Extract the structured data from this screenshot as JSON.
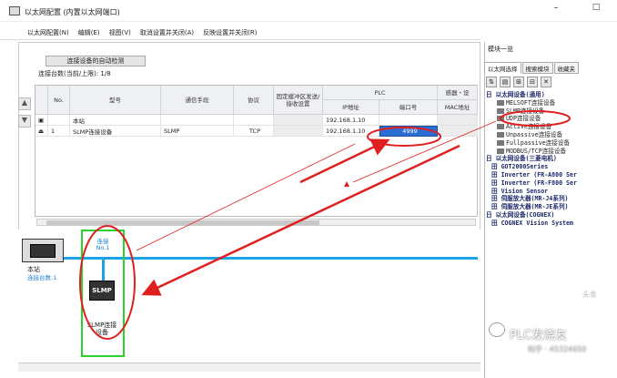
{
  "window": {
    "title": "以太网配置 (内置以太网端口)",
    "min_glyph": "–",
    "max_glyph": "□"
  },
  "menu": [
    "以太网配置(N)",
    "编辑(E)",
    "视图(V)",
    "取消设置并关闭(A)",
    "反映设置并关闭(R)"
  ],
  "toolbar": {
    "detect_label": "连接设备的自动检测",
    "count_label": "连接台数(当前/上限):  1/8"
  },
  "grid": {
    "headers": {
      "no": "No.",
      "model": "型号",
      "comm": "通信手段",
      "protocol": "协议",
      "fixed": "固定缓冲区发送/接收设置",
      "plc_group": "PLC",
      "ip": "IP地址",
      "port": "端口号",
      "sensor": "感器・设",
      "mac": "MAC地址"
    },
    "rows": [
      {
        "no": "",
        "model": "本站",
        "comm": "",
        "protocol": "",
        "ip": "192.168.1.10",
        "port": ""
      },
      {
        "no": "1",
        "model": "SLMP连接设备",
        "comm": "SLMP",
        "protocol": "TCP",
        "ip": "192.168.1.10",
        "port": "4999"
      }
    ]
  },
  "diagram": {
    "station_label": "本站",
    "station_count": "连接台数:1",
    "conn_label": "连接 No.1",
    "slmp_label": "SLMP",
    "device_label": "SLMP连接设备"
  },
  "right_panel": {
    "title": "模块一览",
    "tabs": [
      "以太网选择",
      "搜索模块",
      "收藏夹"
    ],
    "tree": [
      {
        "kind": "grp",
        "label": "日 以太网设备(通用)"
      },
      {
        "kind": "item",
        "label": "MELSOFT连接设备"
      },
      {
        "kind": "item",
        "label": "SLMP连接设备"
      },
      {
        "kind": "item",
        "label": "UDP连接设备"
      },
      {
        "kind": "item",
        "label": "Active连接设备"
      },
      {
        "kind": "item",
        "label": "Unpassive连接设备"
      },
      {
        "kind": "item",
        "label": "Fullpassive连接设备"
      },
      {
        "kind": "item",
        "label": "MODBUS/TCP连接设备"
      },
      {
        "kind": "grp",
        "label": "日 以太网设备(三菱电机)"
      },
      {
        "kind": "sub",
        "label": "田 GOT2000Series"
      },
      {
        "kind": "sub",
        "label": "田 Inverter (FR-A800 Ser"
      },
      {
        "kind": "sub",
        "label": "田 Inverter (FR-F800 Ser"
      },
      {
        "kind": "sub",
        "label": "田 Vision Sensor"
      },
      {
        "kind": "sub",
        "label": "田 伺服放大器(MR-J4系列)"
      },
      {
        "kind": "sub",
        "label": "田 伺服放大器(MR-JE系列)"
      },
      {
        "kind": "grp",
        "label": "日 以太网设备(COGNEX)"
      },
      {
        "kind": "sub",
        "label": "田 COGNEX Vision System"
      }
    ]
  },
  "watermark": {
    "main": "PLC发烧友",
    "sub": "知乎 · 45324650",
    "small": "头条"
  },
  "colors": {
    "network": "#1ea2e6",
    "highlight": "#2a6ed3",
    "annotation": "#e02020",
    "selection_box": "#2bd22b"
  }
}
